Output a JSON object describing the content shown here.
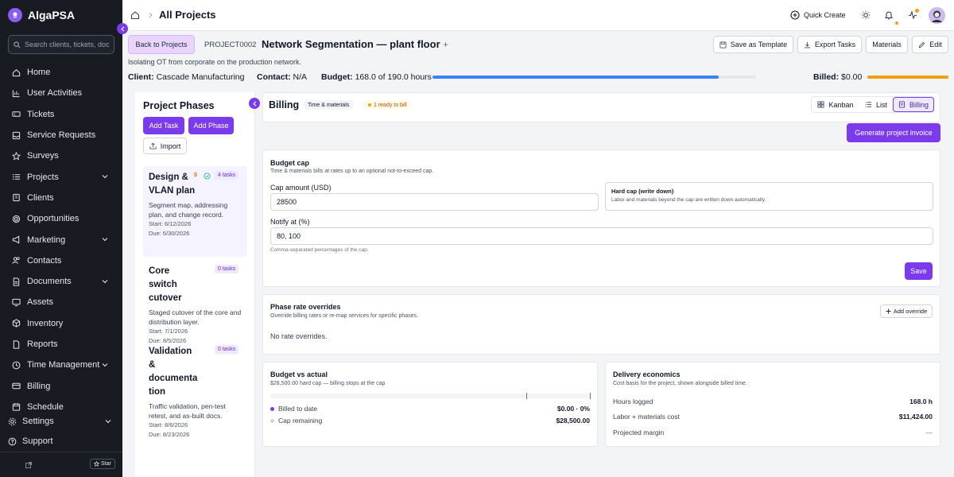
{
  "app": {
    "name": "AlgaPSA"
  },
  "sidebar": {
    "search_placeholder": "Search clients, tickets, doc",
    "items": [
      {
        "label": "Home"
      },
      {
        "label": "User Activities"
      },
      {
        "label": "Tickets"
      },
      {
        "label": "Service Requests"
      },
      {
        "label": "Surveys"
      },
      {
        "label": "Projects"
      },
      {
        "label": "Clients"
      },
      {
        "label": "Opportunities"
      },
      {
        "label": "Marketing"
      },
      {
        "label": "Contacts"
      },
      {
        "label": "Documents"
      },
      {
        "label": "Assets"
      },
      {
        "label": "Inventory"
      },
      {
        "label": "Reports"
      },
      {
        "label": "Time Management"
      },
      {
        "label": "Billing"
      },
      {
        "label": "Schedule"
      }
    ],
    "settings_label": "Settings",
    "support_label": "Support",
    "star_label": "Star"
  },
  "topbar": {
    "title": "All Projects",
    "quick_create": "Quick Create"
  },
  "project": {
    "back_label": "Back to Projects",
    "code": "PROJECT0002",
    "name": "Network Segmentation — plant floor",
    "description": "Isolating OT from corporate on the production network.",
    "client_label": "Client:",
    "client_value": "Cascade Manufacturing",
    "contact_label": "Contact:",
    "contact_value": "N/A",
    "budget_label": "Budget:",
    "budget_value": "168.0 of 190.0 hours",
    "budget_progress": 0.884,
    "billed_label": "Billed:",
    "billed_value": "$0.00",
    "actions": {
      "save_template": "Save as Template",
      "export_tasks": "Export Tasks",
      "materials": "Materials",
      "edit": "Edit"
    }
  },
  "phases": {
    "title": "Project Phases",
    "add_task": "Add Task",
    "add_phase": "Add Phase",
    "import": "Import",
    "items": [
      {
        "name": "Design & VLAN plan",
        "tasks": "4 tasks",
        "desc": "Segment map, addressing plan, and change record.",
        "start": "Start: 6/12/2026",
        "due": "Due: 6/30/2026"
      },
      {
        "name": "Core switch cutover",
        "tasks": "0 tasks",
        "desc": "Staged cutover of the core and distribution layer.",
        "start": "Start: 7/1/2026",
        "due": "Due: 8/5/2026"
      },
      {
        "name": "Validation & documentation",
        "tasks": "0 tasks",
        "desc": "Traffic validation, pen-test retest, and as-built docs.",
        "start": "Start: 8/6/2026",
        "due": "Due: 8/23/2026"
      }
    ]
  },
  "billing": {
    "title": "Billing",
    "type_badge": "Time & materials",
    "ready_badge": "1 ready to bill",
    "views": {
      "kanban": "Kanban",
      "list": "List",
      "billing": "Billing"
    },
    "generate_invoice": "Generate project invoice",
    "budget_cap": {
      "title": "Budget cap",
      "subtitle": "Time & materials bills at rates up to an optional not-to-exceed cap.",
      "cap_label": "Cap amount (USD)",
      "cap_value": "28500",
      "hard_cap_title": "Hard cap (write down)",
      "hard_cap_desc": "Labor and materials beyond the cap are written down automatically.",
      "notify_label": "Notify at (%)",
      "notify_value": "80, 100",
      "notify_help": "Comma-separated percentages of the cap.",
      "save": "Save"
    },
    "overrides": {
      "title": "Phase rate overrides",
      "subtitle": "Override billing rates or re-map services for specific phases.",
      "add": "Add override",
      "empty": "No rate overrides."
    },
    "budget_vs_actual": {
      "title": "Budget vs actual",
      "subtitle": "$28,500.00 hard cap — billing stops at the cap",
      "billed_label": "Billed to date",
      "billed_value": "$0.00 · 0%",
      "remaining_label": "Cap remaining",
      "remaining_value": "$28,500.00"
    },
    "economics": {
      "title": "Delivery economics",
      "subtitle": "Cost basis for the project, shown alongside billed time.",
      "hours_label": "Hours logged",
      "hours_value": "168.0 h",
      "cost_label": "Labor + materials cost",
      "cost_value": "$11,424.00",
      "margin_label": "Projected margin",
      "margin_value": "—"
    }
  },
  "colors": {
    "accent": "#7c3aed",
    "budget_bar": "#3b82f6",
    "billed_bar": "#f59e0b",
    "sidebar_bg": "#181b22"
  }
}
